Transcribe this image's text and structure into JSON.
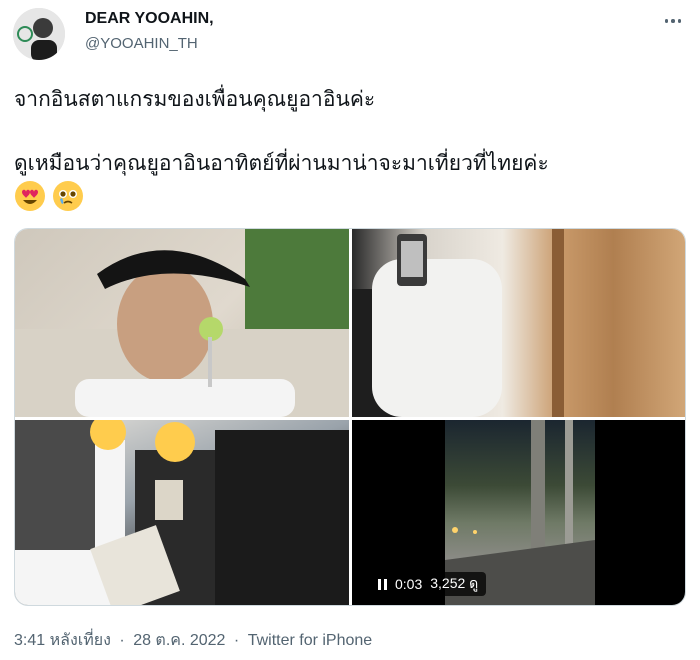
{
  "author": {
    "name": "DEAR YOOAHIN,",
    "handle": "@YOOAHIN_TH"
  },
  "tweet": {
    "line1": "จากอินสตาแกรมของเพื่อนคุณยูอาอินค่ะ",
    "line2": "ดูเหมือนว่าคุณยูอาอินอาทิตย์ที่ผ่านมาน่าจะมาเที่ยวที่ไทยค่ะ",
    "emojis": [
      "heart-eyes-emoji",
      "teary-face-emoji"
    ]
  },
  "media": {
    "video": {
      "duration": "0:03",
      "views": "3,252 ดู"
    }
  },
  "meta": {
    "time": "3:41 หลังเที่ยง",
    "date": "28 ต.ค. 2022",
    "source": "Twitter for iPhone",
    "separator": "·"
  },
  "colors": {
    "text": "#0f1419",
    "secondary": "#536471",
    "border": "#cfd9de"
  }
}
